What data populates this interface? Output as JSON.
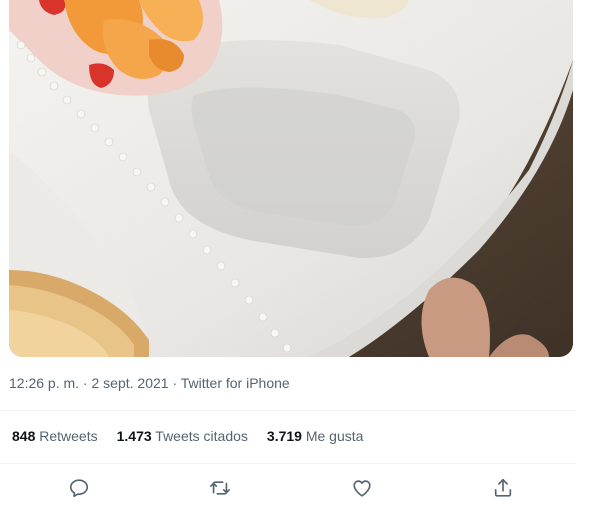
{
  "tweet": {
    "time": "12:26 p. m.",
    "date": "2 sept. 2021",
    "source": "Twitter for iPhone",
    "separator": " · "
  },
  "stats": {
    "retweets": {
      "count": "848",
      "label": "Retweets"
    },
    "quotes": {
      "count": "1.473",
      "label": "Tweets citados"
    },
    "likes": {
      "count": "3.719",
      "label": "Me gusta"
    }
  },
  "actions": [
    "reply-icon",
    "retweet-icon",
    "like-icon",
    "share-icon"
  ],
  "colors": {
    "muted_text": "#536471",
    "primary_text": "#0f1419",
    "divider": "#eff3f4"
  }
}
